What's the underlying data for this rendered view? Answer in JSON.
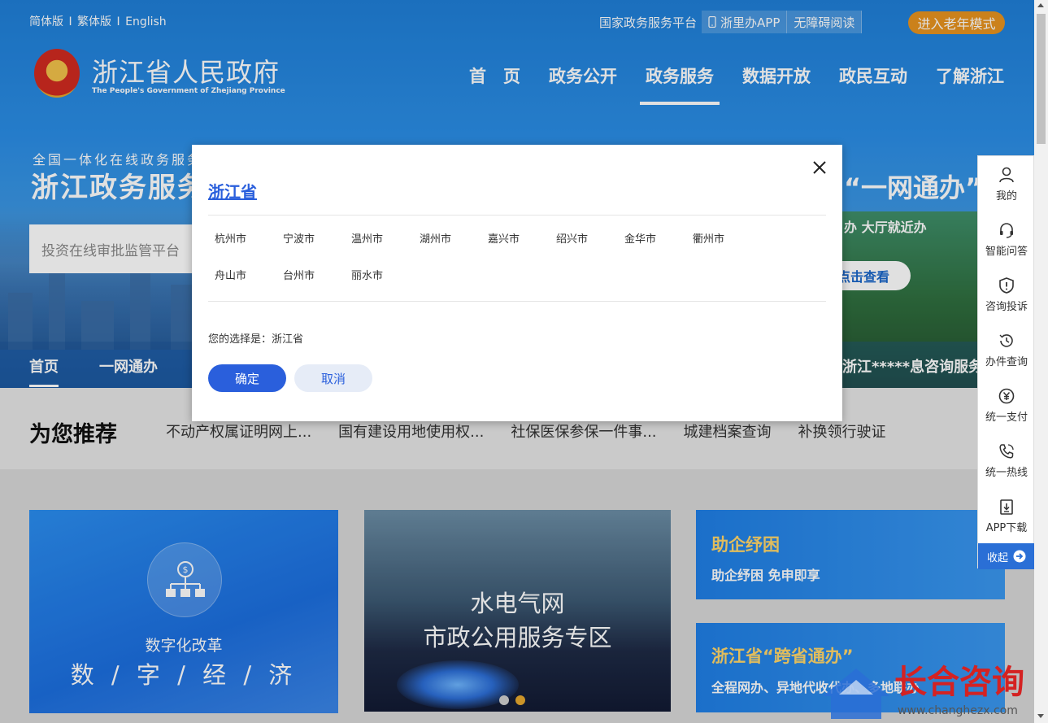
{
  "topbar": {
    "lang": [
      "简体版",
      "I",
      "繁体版",
      "I",
      "English"
    ],
    "platform": "国家政务服务平台",
    "app_btn": "浙里办APP",
    "access_btn": "无障碍阅读",
    "elder_btn": "进入老年模式"
  },
  "brand": {
    "title": "浙江省人民政府",
    "subtitle": "The People's Government of Zhejiang Province"
  },
  "nav": {
    "items": [
      {
        "label": "首　页"
      },
      {
        "label": "政务公开"
      },
      {
        "label": "政务服务"
      },
      {
        "label": "数据开放"
      },
      {
        "label": "政民互动"
      },
      {
        "label": "了解浙江"
      }
    ],
    "active": "政务服务"
  },
  "hero": {
    "kicker": "全国一体化在线政务服务",
    "big": "浙江政务服务",
    "right_big": "“一网通办”",
    "right_sub": "办 大厅就近办",
    "check_btn": "点击查看",
    "search_placeholder": "投资在线审批监管平台",
    "tabs": [
      "首页",
      "一网通办"
    ],
    "tabs_right": "浙江*****息咨询服务"
  },
  "recommend": {
    "title": "为您推荐",
    "links": [
      "不动产权属证明网上...",
      "国有建设用地使用权...",
      "社保医保参保一件事...",
      "城建档案查询",
      "补换领行驶证"
    ]
  },
  "cards": {
    "digital": {
      "sub": "数字化改革",
      "main": "数 / 字 / 经 / 济"
    },
    "utility": {
      "l1": "水电气网",
      "l2": "市政公用服务专区"
    },
    "aid": {
      "t1": "助企纾困",
      "t2": "助企纾困 免申即享"
    },
    "cross": {
      "t1": "浙江省“跨省通办”",
      "t2": "全程网办、异地代收代办、多地联办"
    }
  },
  "modal": {
    "province": "浙江省",
    "cities": [
      "杭州市",
      "宁波市",
      "温州市",
      "湖州市",
      "嘉兴市",
      "绍兴市",
      "金华市",
      "衢州市",
      "舟山市",
      "台州市",
      "丽水市"
    ],
    "choice": "您的选择是：浙江省",
    "ok": "确定",
    "cancel": "取消"
  },
  "sidebar": {
    "items": [
      {
        "label": "我的",
        "icon": "user-icon"
      },
      {
        "label": "智能问答",
        "icon": "headset-icon"
      },
      {
        "label": "咨询投诉",
        "icon": "shield-alert-icon"
      },
      {
        "label": "办件查询",
        "icon": "history-icon"
      },
      {
        "label": "统一支付",
        "icon": "yuan-icon"
      },
      {
        "label": "统一热线",
        "icon": "phone-icon"
      },
      {
        "label": "APP下载",
        "icon": "download-icon"
      }
    ],
    "collapse": "收起"
  },
  "watermark": {
    "text": "长合咨询",
    "url": "www.changhezx.com"
  },
  "colors": {
    "primary": "#2a5fdc",
    "accent": "#e8931f",
    "watermark": "#d42222"
  }
}
